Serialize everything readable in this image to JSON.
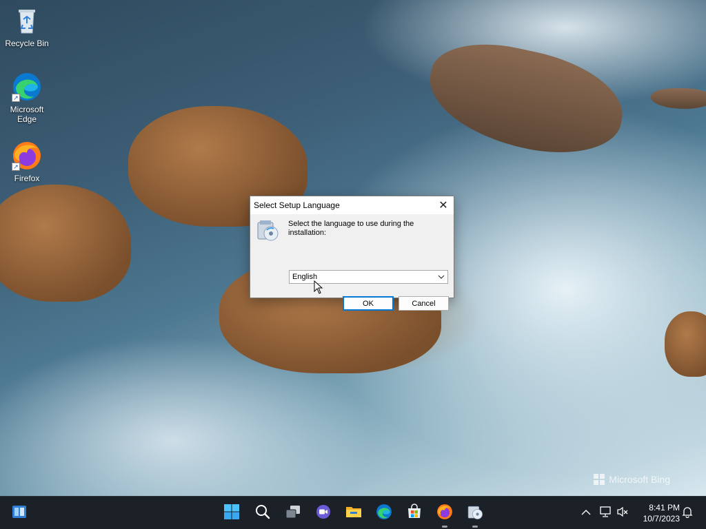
{
  "desktop": {
    "icons": [
      {
        "label": "Recycle Bin",
        "icon": "recycle-bin-icon"
      },
      {
        "label": "Microsoft\nEdge",
        "icon": "edge-icon"
      },
      {
        "label": "Firefox",
        "icon": "firefox-icon"
      }
    ],
    "watermark": "Microsoft Bing"
  },
  "dialog": {
    "title": "Select Setup Language",
    "message": "Select the language to use during the installation:",
    "language_selected": "English",
    "ok_label": "OK",
    "cancel_label": "Cancel"
  },
  "taskbar": {
    "pinned": [
      {
        "name": "start-button",
        "icon": "windows-logo-icon"
      },
      {
        "name": "search-button",
        "icon": "search-icon"
      },
      {
        "name": "task-view-button",
        "icon": "task-view-icon"
      },
      {
        "name": "meet-button",
        "icon": "meet-camera-icon"
      },
      {
        "name": "file-explorer-button",
        "icon": "folder-icon"
      },
      {
        "name": "edge-button",
        "icon": "edge-icon"
      },
      {
        "name": "store-button",
        "icon": "store-icon"
      },
      {
        "name": "firefox-button",
        "icon": "firefox-icon"
      },
      {
        "name": "setup-button",
        "icon": "setup-icon"
      }
    ],
    "time": "8:41 PM",
    "date": "10/7/2023"
  },
  "colors": {
    "taskbar_bg": "#1c2128",
    "accent": "#0078d4",
    "dialog_bg": "#f0f0f0"
  }
}
